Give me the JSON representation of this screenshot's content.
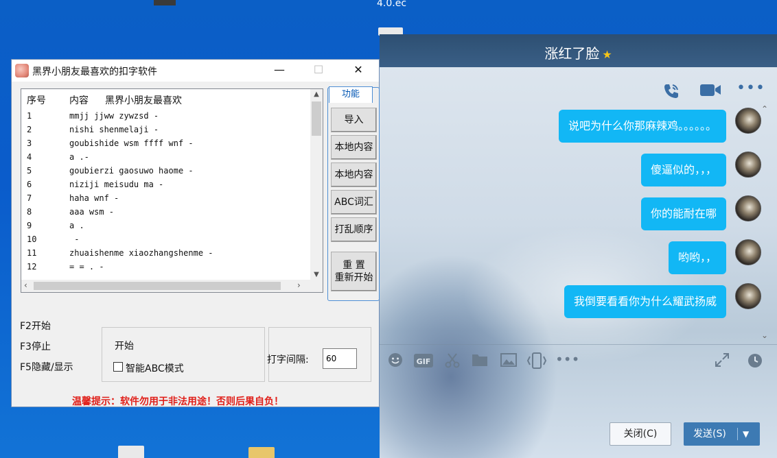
{
  "desktop": {
    "file_label": "4.0.ec"
  },
  "app": {
    "title": "黑界小朋友最喜欢的扣字软件",
    "window_controls": {
      "minimize": "—",
      "maximize": "☐",
      "close": "✕"
    },
    "list": {
      "headers": [
        "序号",
        "内容",
        "黑界小朋友最喜欢"
      ],
      "rows": [
        {
          "n": "1",
          "text": "mmjj jjww zywzsd -"
        },
        {
          "n": "2",
          "text": "nishi shenmelaji -"
        },
        {
          "n": "3",
          "text": "goubishide wsm ffff wnf -"
        },
        {
          "n": "4",
          "text": "a .-"
        },
        {
          "n": "5",
          "text": "goubierzi gaosuwo haome -"
        },
        {
          "n": "6",
          "text": "niziji meisudu ma -"
        },
        {
          "n": "7",
          "text": "haha wnf -"
        },
        {
          "n": "8",
          "text": "aaa wsm -"
        },
        {
          "n": "9",
          "text": "a ."
        },
        {
          "n": "10",
          "text": " -"
        },
        {
          "n": "11",
          "text": "zhuaishenme xiaozhangshenme -"
        },
        {
          "n": "12",
          "text": "= = . -"
        }
      ]
    },
    "func_tab": "功能",
    "buttons": {
      "import": "导入",
      "local1": "本地内容",
      "local2": "本地内容",
      "abc": "ABC词汇",
      "shuffle": "打乱顺序",
      "reset_line1": "重 置",
      "reset_line2": "重新开始"
    },
    "hotkeys": [
      "F2开始",
      "F3停止",
      "F5隐藏/显示"
    ],
    "status_label": "开始",
    "smart_abc_label": "智能ABC模式",
    "interval_label": "打字间隔:",
    "interval_value": "60",
    "warning": "温馨提示：软件勿用于非法用途！否则后果自负！"
  },
  "chat": {
    "contact_name": "涨红了脸",
    "messages": [
      "说吧为什么你那麻辣鸡。。。。。。",
      "傻逼似的，，，",
      "你的能耐在哪",
      "哟哟，，",
      "我倒要看看你为什么耀武扬威"
    ],
    "close_button": "关闭(C)",
    "send_button": "发送(S)",
    "icons": [
      "phone-icon",
      "video-icon",
      "more-icon",
      "emoji-icon",
      "gif-icon",
      "scissors-icon",
      "folder-icon",
      "image-icon",
      "shake-icon",
      "more-tools-icon",
      "expand-icon",
      "history-icon"
    ]
  }
}
